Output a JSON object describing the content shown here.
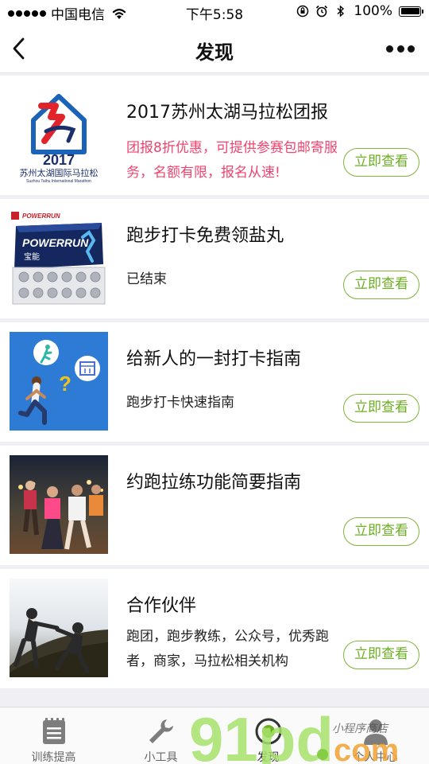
{
  "status_bar": {
    "carrier": "中国电信",
    "time": "下午5:58",
    "battery": "100%"
  },
  "nav": {
    "title": "发现",
    "back_icon": "chevron-left-icon",
    "more_icon": "more-dots-icon"
  },
  "cards": [
    {
      "title": "2017苏州太湖马拉松团报",
      "description": "团报8折优惠，可提供参赛包邮寄服务，名额有限，报名从速!",
      "button": "立即查看",
      "thumb_year": "2017",
      "thumb_caption": "苏州太湖国际马拉松",
      "thumb_caption_en": "Suzhou Taihu International Marathon"
    },
    {
      "title": "跑步打卡免费领盐丸",
      "description": "已结束",
      "button": "立即查看",
      "thumb_brand": "POWERRUN",
      "thumb_brand_cn": "宝能"
    },
    {
      "title": "给新人的一封打卡指南",
      "description": "跑步打卡快速指南",
      "button": "立即查看"
    },
    {
      "title": "约跑拉练功能简要指南",
      "description": "",
      "button": "立即查看"
    },
    {
      "title": "合作伙伴",
      "description": "跑团，跑步教练，公众号，优秀跑者，商家，马拉松相关机构",
      "button": "立即查看"
    }
  ],
  "tabs": [
    {
      "label": "训练提高",
      "icon": "notepad-icon"
    },
    {
      "label": "小工具",
      "icon": "wrench-icon"
    },
    {
      "label": "发现",
      "icon": "compass-icon",
      "active": true
    },
    {
      "label": "个人中心",
      "icon": "person-icon"
    }
  ],
  "watermark": {
    "text": "91pd.com",
    "subtext": "小程序商店"
  },
  "colors": {
    "accent_green": "#6cae22",
    "promo_pink": "#f0436e",
    "background": "#efeff4"
  }
}
